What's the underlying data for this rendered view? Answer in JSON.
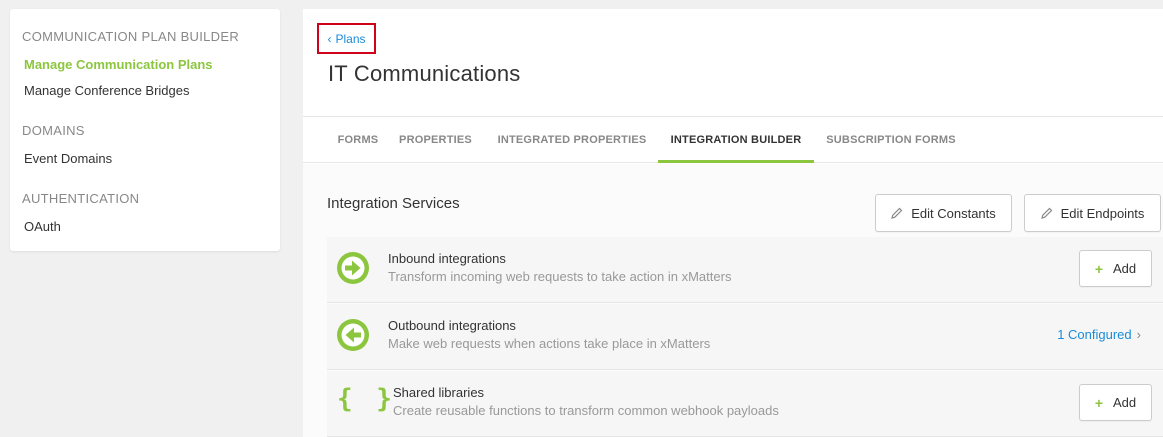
{
  "sidebar": {
    "section1_heading": "COMMUNICATION PLAN BUILDER",
    "item_manage_plans": "Manage Communication Plans",
    "item_conference_bridges": "Manage Conference Bridges",
    "section2_heading": "DOMAINS",
    "item_event_domains": "Event Domains",
    "section3_heading": "AUTHENTICATION",
    "item_oauth": "OAuth"
  },
  "header": {
    "back_label": "Plans",
    "title": "IT Communications"
  },
  "tabs": [
    {
      "label": "FORMS"
    },
    {
      "label": "PROPERTIES"
    },
    {
      "label": "INTEGRATED PROPERTIES"
    },
    {
      "label": "INTEGRATION BUILDER"
    },
    {
      "label": "SUBSCRIPTION FORMS"
    }
  ],
  "section": {
    "title": "Integration Services",
    "edit_constants_label": "Edit Constants",
    "edit_endpoints_label": "Edit Endpoints"
  },
  "rows": [
    {
      "title": "Inbound integrations",
      "description": "Transform incoming web requests to take action in xMatters",
      "action_label": "Add"
    },
    {
      "title": "Outbound integrations",
      "description": "Make web requests when actions take place in xMatters",
      "status_link": "1 Configured"
    },
    {
      "title": "Shared libraries",
      "description": "Create reusable functions to transform common webhook payloads",
      "action_label": "Add",
      "icon_glyph": "{ }"
    }
  ],
  "colors": {
    "accent_green": "#8cc63f",
    "link_blue": "#1a8cd8",
    "highlight_red": "#d0021b"
  },
  "icons": {
    "back": "chevron-left-icon",
    "edit": "pencil-icon",
    "add": "plus-icon",
    "inbound": "arrow-right-circle-icon",
    "outbound": "arrow-left-circle-icon",
    "libraries": "braces-icon",
    "status_link": "chevron-right-icon"
  }
}
